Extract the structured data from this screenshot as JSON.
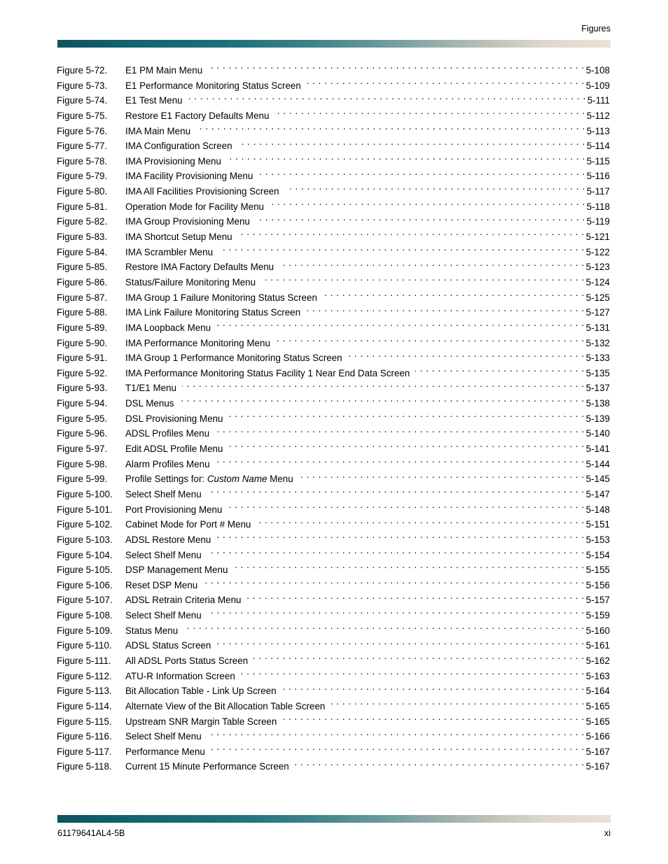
{
  "header": {
    "title": "Figures"
  },
  "footer": {
    "document_number": "61179641AL4-5B",
    "page_number": "xi"
  },
  "toc": {
    "entries": [
      {
        "label": "Figure 5-72.",
        "title": "E1 PM Main Menu",
        "page": "5-108"
      },
      {
        "label": "Figure 5-73.",
        "title": "E1 Performance Monitoring Status Screen",
        "page": "5-109"
      },
      {
        "label": "Figure 5-74.",
        "title": "E1 Test Menu",
        "page": "5-111"
      },
      {
        "label": "Figure 5-75.",
        "title": "Restore E1 Factory Defaults Menu",
        "page": "5-112"
      },
      {
        "label": "Figure 5-76.",
        "title": "IMA Main Menu",
        "page": "5-113"
      },
      {
        "label": "Figure 5-77.",
        "title": "IMA Configuration Screen",
        "page": "5-114"
      },
      {
        "label": "Figure 5-78.",
        "title": "IMA Provisioning Menu",
        "page": "5-115"
      },
      {
        "label": "Figure 5-79.",
        "title": "IMA Facility Provisioning Menu",
        "page": "5-116"
      },
      {
        "label": "Figure 5-80.",
        "title": "IMA All Facilities Provisioning Screen",
        "page": "5-117"
      },
      {
        "label": "Figure 5-81.",
        "title": "Operation Mode for Facility Menu",
        "page": "5-118"
      },
      {
        "label": "Figure 5-82.",
        "title": "IMA Group Provisioning Menu",
        "page": "5-119"
      },
      {
        "label": "Figure 5-83.",
        "title": "IMA Shortcut Setup Menu",
        "page": "5-121"
      },
      {
        "label": "Figure 5-84.",
        "title": "IMA Scrambler Menu",
        "page": "5-122"
      },
      {
        "label": "Figure 5-85.",
        "title": "Restore IMA Factory Defaults Menu",
        "page": "5-123"
      },
      {
        "label": "Figure 5-86.",
        "title": "Status/Failure Monitoring Menu",
        "page": "5-124"
      },
      {
        "label": "Figure 5-87.",
        "title": "IMA Group 1 Failure Monitoring Status Screen",
        "page": "5-125"
      },
      {
        "label": "Figure 5-88.",
        "title": "IMA Link Failure Monitoring Status Screen",
        "page": "5-127"
      },
      {
        "label": "Figure 5-89.",
        "title": "IMA Loopback Menu",
        "page": "5-131"
      },
      {
        "label": "Figure 5-90.",
        "title": "IMA Performance Monitoring Menu",
        "page": "5-132"
      },
      {
        "label": "Figure 5-91.",
        "title": "IMA Group 1 Performance Monitoring Status Screen",
        "page": "5-133"
      },
      {
        "label": "Figure 5-92.",
        "title": "IMA Performance Monitoring Status Facility 1 Near End Data Screen",
        "page": "5-135"
      },
      {
        "label": "Figure 5-93.",
        "title": "T1/E1 Menu",
        "page": "5-137"
      },
      {
        "label": "Figure 5-94.",
        "title": "DSL Menus",
        "page": "5-138"
      },
      {
        "label": "Figure 5-95.",
        "title": "DSL Provisioning Menu",
        "page": "5-139"
      },
      {
        "label": "Figure 5-96.",
        "title": "ADSL Profiles Menu",
        "page": "5-140"
      },
      {
        "label": "Figure 5-97.",
        "title": "Edit ADSL Profile Menu",
        "page": "5-141"
      },
      {
        "label": "Figure 5-98.",
        "title": "Alarm Profiles Menu",
        "page": "5-144"
      },
      {
        "label": "Figure 5-99.",
        "title": "Profile Settings for: Custom Name Menu",
        "title_prefix": "Profile Settings for: ",
        "title_italic": "Custom Name",
        "title_suffix": " Menu",
        "page": "5-145"
      },
      {
        "label": "Figure 5-100.",
        "title": "Select Shelf Menu",
        "page": "5-147"
      },
      {
        "label": "Figure 5-101.",
        "title": "Port Provisioning Menu",
        "page": "5-148"
      },
      {
        "label": "Figure 5-102.",
        "title": "Cabinet Mode for Port # Menu",
        "page": "5-151"
      },
      {
        "label": "Figure 5-103.",
        "title": "ADSL Restore Menu",
        "page": "5-153"
      },
      {
        "label": "Figure 5-104.",
        "title": "Select Shelf Menu",
        "page": "5-154"
      },
      {
        "label": "Figure 5-105.",
        "title": "DSP Management Menu",
        "page": "5-155"
      },
      {
        "label": "Figure 5-106.",
        "title": "Reset DSP Menu",
        "page": "5-156"
      },
      {
        "label": "Figure 5-107.",
        "title": "ADSL Retrain Criteria Menu",
        "page": "5-157"
      },
      {
        "label": "Figure 5-108.",
        "title": "Select Shelf Menu",
        "page": "5-159"
      },
      {
        "label": "Figure 5-109.",
        "title": "Status Menu",
        "page": "5-160"
      },
      {
        "label": "Figure 5-110.",
        "title": "ADSL Status Screen",
        "page": "5-161"
      },
      {
        "label": "Figure 5-111.",
        "title": "All ADSL Ports Status Screen",
        "page": "5-162"
      },
      {
        "label": "Figure 5-112.",
        "title": "ATU-R Information Screen",
        "page": "5-163"
      },
      {
        "label": "Figure 5-113.",
        "title": "Bit Allocation Table - Link Up Screen",
        "page": "5-164"
      },
      {
        "label": "Figure 5-114.",
        "title": "Alternate View of the Bit Allocation Table Screen",
        "page": "5-165"
      },
      {
        "label": "Figure 5-115.",
        "title": "Upstream SNR Margin Table Screen",
        "page": "5-165"
      },
      {
        "label": "Figure 5-116.",
        "title": "Select Shelf Menu",
        "page": "5-166"
      },
      {
        "label": "Figure 5-117.",
        "title": "Performance Menu",
        "page": "5-167"
      },
      {
        "label": "Figure 5-118.",
        "title": "Current 15 Minute Performance Screen",
        "page": "5-167"
      }
    ]
  },
  "colors": {
    "rule_start": "#0d5360",
    "rule_mid": "#79a0a2",
    "rule_end": "#e9e2d5",
    "text": "#000000"
  }
}
